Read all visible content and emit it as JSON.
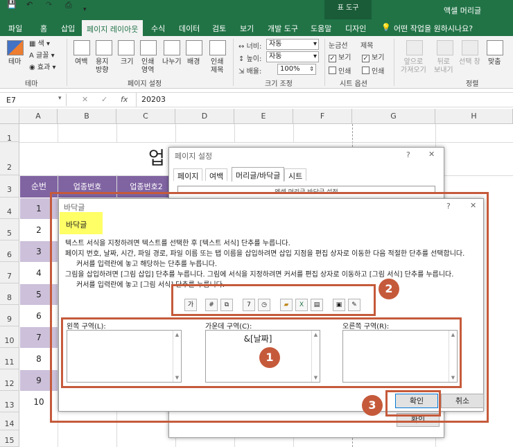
{
  "titlebar": {
    "table_tools": "표 도구",
    "app_title": "액셀 머리글"
  },
  "tabs": [
    "파일",
    "홈",
    "삽입",
    "페이지 레이아웃",
    "수식",
    "데이터",
    "검토",
    "보기",
    "개발 도구",
    "도움말",
    "디자인"
  ],
  "tell_me": "어떤 작업을 원하시나요?",
  "ribbon": {
    "themes": {
      "theme": "테마",
      "colors": "색",
      "fonts": "글꼴",
      "effects": "효과",
      "group": "테마"
    },
    "page_setup": {
      "margins": "여백",
      "orientation": [
        "용지",
        "방향"
      ],
      "size": "크기",
      "print_area": [
        "인쇄",
        "영역"
      ],
      "breaks": "나누기",
      "background": "배경",
      "print_titles": [
        "인쇄",
        "제목"
      ],
      "group": "페이지 설정"
    },
    "scale": {
      "width_label": "너비:",
      "width_value": "자동",
      "height_label": "높이:",
      "height_value": "자동",
      "scale_label": "배율:",
      "scale_value": "100%",
      "group": "크기 조정"
    },
    "sheet_options": {
      "gridlines": "눈금선",
      "headings": "제목",
      "view": "보기",
      "print": "인쇄",
      "group": "시트 옵션"
    },
    "arrange": {
      "bring_forward": [
        "앞으로",
        "가져오기"
      ],
      "send_backward": [
        "뒤로",
        "보내기"
      ],
      "selection_pane": [
        "선택 창"
      ],
      "align": [
        "맞춤"
      ],
      "group": "정렬"
    }
  },
  "formula_bar": {
    "name_box": "E7",
    "fx": "fx",
    "value": "20203"
  },
  "columns": [
    "A",
    "B",
    "C",
    "D",
    "E",
    "F",
    "G",
    "H"
  ],
  "rows": [
    "1",
    "2",
    "3",
    "4",
    "5",
    "6",
    "7",
    "8",
    "9",
    "10",
    "11",
    "12",
    "13",
    "14",
    "15"
  ],
  "sheet": {
    "title_partial": "업",
    "header_no": "순번",
    "header_code1": "업종번호",
    "header_code2": "업종번호2",
    "numbers": [
      "1",
      "2",
      "3",
      "4",
      "5",
      "6",
      "7",
      "8",
      "9",
      "10"
    ]
  },
  "page_setup_dialog": {
    "title": "페이지 설정",
    "help": "?",
    "close": "✕",
    "tabs": [
      "페이지",
      "여백",
      "머리글/바닥글",
      "시트"
    ],
    "preview_text": "엑셀 머리글 바닥글 설정",
    "ok": "확인"
  },
  "footer_dialog": {
    "title": "바닥글",
    "help": "?",
    "close": "✕",
    "tab": "바닥글",
    "instructions": [
      "텍스트 서식을 지정하려면 텍스트를 선택한 후 [텍스트 서식] 단추를 누릅니다.",
      "페이지 번호, 날짜, 시간, 파일 경로, 파일 이름 또는 탭 이름을 삽입하려면 삽입 지점을 편집 상자로 이동한 다음 적절한 단추를 선택합니다.",
      "커서를 입력란에 놓고 해당하는 단추를 누릅니다.",
      "그림을 삽입하려면 [그림 삽입] 단추를 누릅니다.  그림에 서식을 지정하려면 커서를 편집 상자로 이동하고 [그림 서식] 단추를 누릅니다.",
      "커서를 입력란에 놓고 [그림 서식] 단추를 누릅니다."
    ],
    "toolbar_icons": [
      "format-text-icon",
      "page-number-icon",
      "page-count-icon",
      "date-icon",
      "time-icon",
      "file-path-icon",
      "file-name-icon",
      "sheet-name-icon",
      "insert-picture-icon",
      "format-picture-icon"
    ],
    "left_label": "왼쪽 구역(L):",
    "center_label": "가운데 구역(C):",
    "right_label": "오른쪽 구역(R):",
    "left_value": "",
    "center_value": "&[날짜]",
    "right_value": "",
    "ok": "확인",
    "cancel": "취소"
  },
  "badges": [
    "1",
    "2",
    "3"
  ],
  "colors": {
    "excel_green": "#217346",
    "purple": "#8064a2",
    "lavender": "#ccc0da",
    "highlight": "#ffff66",
    "annotation": "#c55a3b"
  }
}
